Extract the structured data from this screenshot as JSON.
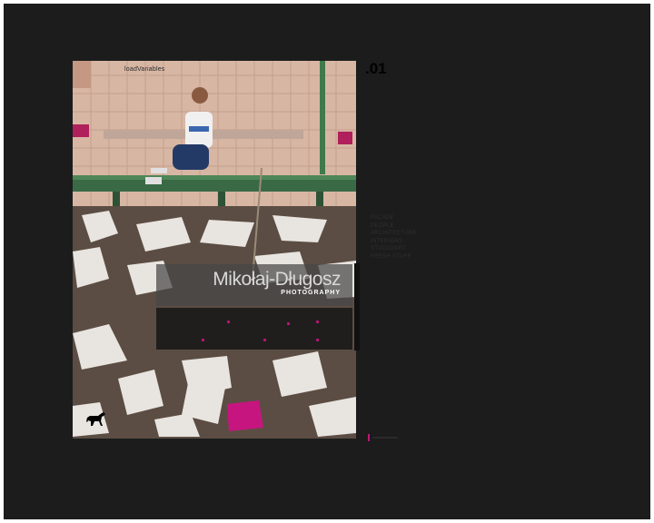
{
  "photo": {
    "tag": "loadVariables",
    "alt_icon": "dog-logo-icon"
  },
  "counter": ".01",
  "nav": {
    "items": [
      "FAÇADE",
      "PEOPLE",
      "ARCHITECTURE",
      "INTERIORS",
      "STUDIO/ART",
      "FRESH STUFF"
    ]
  },
  "brand": {
    "name": "Mikołaj-Długosz",
    "subtitle": "PHOTOGRAPHY"
  },
  "colors": {
    "background": "#1c1c1c",
    "accent": "#c0157a",
    "frame": "#ffffff"
  }
}
